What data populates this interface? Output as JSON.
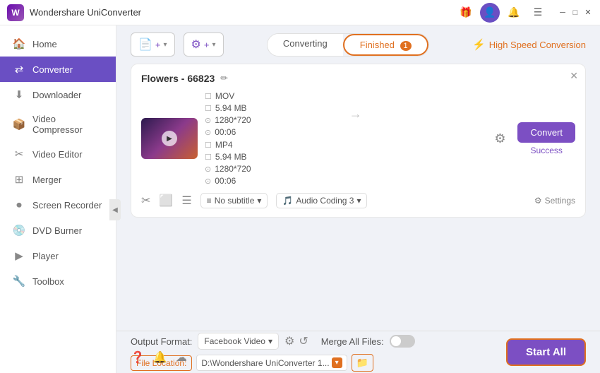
{
  "app": {
    "title": "Wondershare UniConverter",
    "logo_letter": "W"
  },
  "title_bar": {
    "icons": [
      "gift-icon",
      "user-icon",
      "bell-icon",
      "menu-icon"
    ],
    "window_controls": [
      "minimize",
      "maximize",
      "close"
    ]
  },
  "sidebar": {
    "items": [
      {
        "id": "home",
        "label": "Home",
        "icon": "🏠"
      },
      {
        "id": "converter",
        "label": "Converter",
        "icon": "⇄",
        "active": true
      },
      {
        "id": "downloader",
        "label": "Downloader",
        "icon": "↓"
      },
      {
        "id": "video-compressor",
        "label": "Video Compressor",
        "icon": "📦"
      },
      {
        "id": "video-editor",
        "label": "Video Editor",
        "icon": "✂"
      },
      {
        "id": "merger",
        "label": "Merger",
        "icon": "⊞"
      },
      {
        "id": "screen-recorder",
        "label": "Screen Recorder",
        "icon": "⏺"
      },
      {
        "id": "dvd-burner",
        "label": "DVD Burner",
        "icon": "💿"
      },
      {
        "id": "player",
        "label": "Player",
        "icon": "▶"
      },
      {
        "id": "toolbox",
        "label": "Toolbox",
        "icon": "🔧"
      }
    ]
  },
  "top_bar": {
    "add_button_label": "+",
    "format_button_label": "+",
    "tabs": [
      {
        "id": "converting",
        "label": "Converting",
        "active": false,
        "badge": null
      },
      {
        "id": "finished",
        "label": "Finished",
        "active": true,
        "badge": "1"
      }
    ],
    "high_speed_label": "High Speed Conversion"
  },
  "file_card": {
    "title": "Flowers - 66823",
    "source": {
      "format": "MOV",
      "resolution": "1280*720",
      "size": "5.94 MB",
      "duration": "00:06"
    },
    "output": {
      "format": "MP4",
      "resolution": "1280*720",
      "size": "5.94 MB",
      "duration": "00:06"
    },
    "subtitle": "No subtitle",
    "audio": "Audio Coding 3",
    "settings_label": "Settings",
    "convert_label": "Convert",
    "status": "Success"
  },
  "bottom_bar": {
    "output_format_label": "Output Format:",
    "format_value": "Facebook Video",
    "merge_label": "Merge All Files:",
    "file_location_label": "File Location:",
    "file_path": "D:\\Wondershare UniConverter 1...",
    "start_all_label": "Start All"
  },
  "status_bar": {
    "icons": [
      "help-icon",
      "bell-icon",
      "settings-icon"
    ]
  }
}
